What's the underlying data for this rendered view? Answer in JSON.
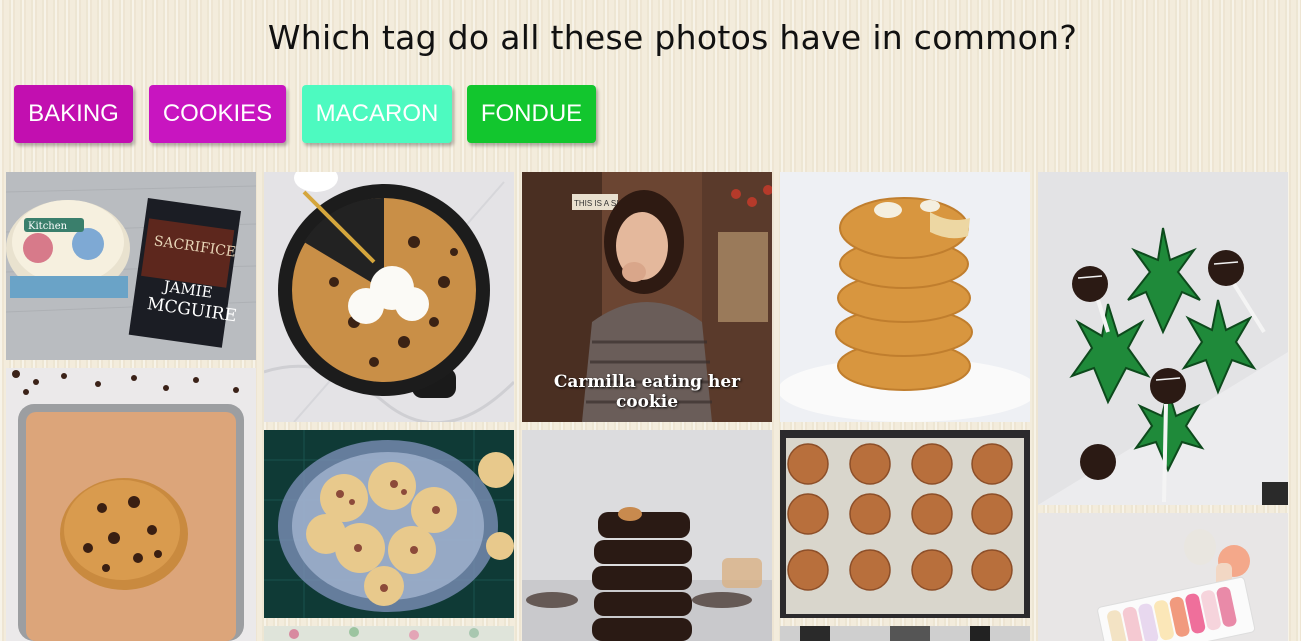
{
  "question": "Which tag do all these photos have in common?",
  "tags": [
    {
      "label": "BAKING",
      "color": "#c20fb0"
    },
    {
      "label": "COOKIES",
      "color": "#c815c0"
    },
    {
      "label": "MACARON",
      "color": "#4dfac0"
    },
    {
      "label": "FONDUE",
      "color": "#12c62e"
    }
  ],
  "photos": {
    "kitchen_tin_book": {
      "book_title": "SACRIFICE",
      "book_author_1": "JAMIE",
      "book_author_2": "MCGUIRE",
      "tin_label": "Kitchen"
    },
    "girl_eating_cookie": {
      "caption": "Carmilla eating her cookie",
      "sign_text": "THIS IS A SIGN"
    }
  }
}
